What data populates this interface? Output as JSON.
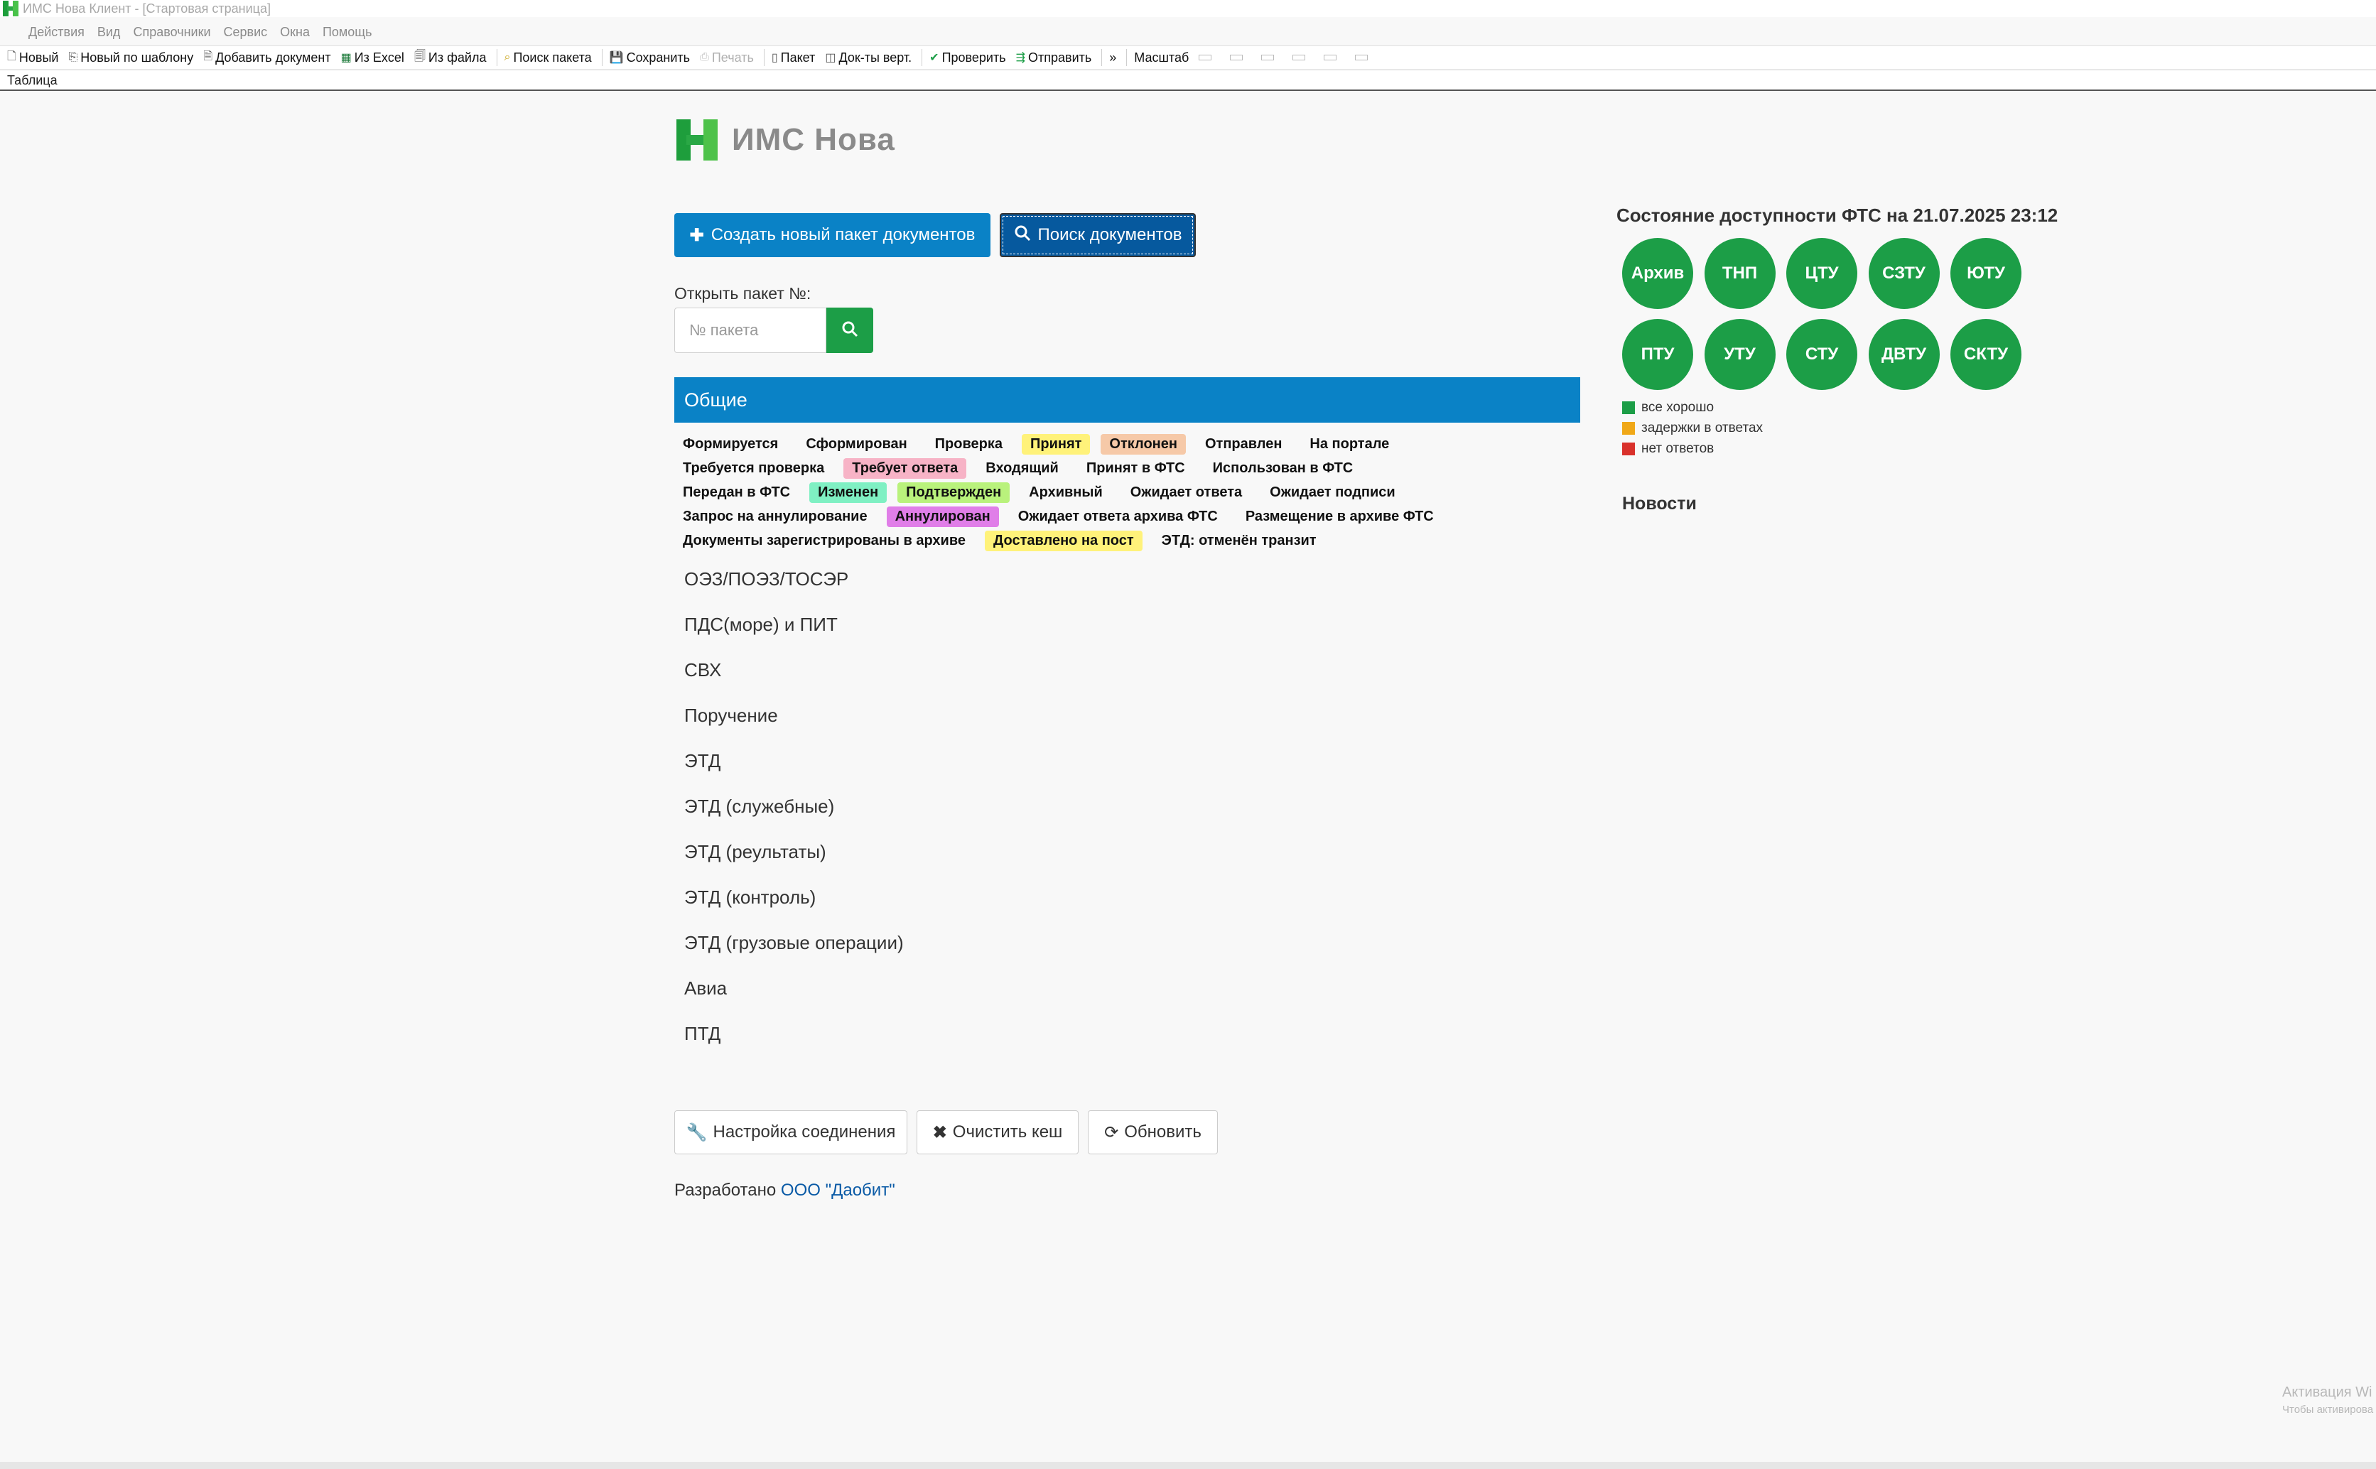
{
  "window": {
    "title": "ИМС Нова Клиент - [Стартовая страница]"
  },
  "menu": [
    "Действия",
    "Вид",
    "Справочники",
    "Сервис",
    "Окна",
    "Помощь"
  ],
  "toolbar": {
    "new": "Новый",
    "new_template": "Новый по шаблону",
    "add_doc": "Добавить документ",
    "from_excel": "Из Excel",
    "from_file": "Из файла",
    "search_pkg": "Поиск пакета",
    "save": "Сохранить",
    "print": "Печать",
    "package": "Пакет",
    "docs_vert": "Док-ты верт.",
    "check": "Проверить",
    "send": "Отправить",
    "more": "»",
    "scale": "Масштаб"
  },
  "tab": "Таблица",
  "logo_text": "ИМС Нова",
  "actions": {
    "create": "Создать новый пакет документов",
    "search": "Поиск документов"
  },
  "open_pkg": {
    "label": "Открыть пакет №:",
    "placeholder": "№ пакета"
  },
  "section_title": "Общие",
  "statuses": [
    [
      {
        "label": "Формируется",
        "bg": ""
      },
      {
        "label": "Сформирован",
        "bg": ""
      },
      {
        "label": "Проверка",
        "bg": ""
      },
      {
        "label": "Принят",
        "bg": "#fff27a"
      },
      {
        "label": "Отклонен",
        "bg": "#f6c9a8"
      },
      {
        "label": "Отправлен",
        "bg": ""
      },
      {
        "label": "На портале",
        "bg": ""
      }
    ],
    [
      {
        "label": "Требуется проверка",
        "bg": ""
      },
      {
        "label": "Требует ответа",
        "bg": "#f7b3c6"
      },
      {
        "label": "Входящий",
        "bg": ""
      },
      {
        "label": "Принят в ФТС",
        "bg": ""
      },
      {
        "label": "Использован в ФТС",
        "bg": ""
      }
    ],
    [
      {
        "label": "Передан в ФТС",
        "bg": ""
      },
      {
        "label": "Изменен",
        "bg": "#7ff0c3"
      },
      {
        "label": "Подтвержден",
        "bg": "#b9f27c"
      },
      {
        "label": "Архивный",
        "bg": ""
      },
      {
        "label": "Ожидает ответа",
        "bg": ""
      },
      {
        "label": "Ожидает подписи",
        "bg": ""
      }
    ],
    [
      {
        "label": "Запрос на аннулирование",
        "bg": ""
      },
      {
        "label": "Аннулирован",
        "bg": "#e07ee8"
      },
      {
        "label": "Ожидает ответа архива ФТС",
        "bg": ""
      },
      {
        "label": "Размещение в архиве ФТС",
        "bg": ""
      }
    ],
    [
      {
        "label": "Документы зарегистрированы в архиве",
        "bg": ""
      },
      {
        "label": "Доставлено на пост",
        "bg": "#fff27a"
      },
      {
        "label": "ЭТД: отменён транзит",
        "bg": ""
      }
    ]
  ],
  "doc_groups": [
    "ОЭЗ/ПОЭЗ/ТОСЭР",
    "ПДС(море) и ПИТ",
    "СВХ",
    "Поручение",
    "ЭТД",
    "ЭТД (служебные)",
    "ЭТД (реультаты)",
    "ЭТД (контроль)",
    "ЭТД (грузовые операции)",
    "Авиа",
    "ПТД"
  ],
  "footer_buttons": {
    "connection": "Настройка соединения",
    "cache": "Очистить кеш",
    "refresh": "Обновить"
  },
  "credit": {
    "prefix": "Разработано ",
    "link": "ООО \"Даобит\""
  },
  "fts": {
    "title": "Состояние доступности ФТС на 21.07.2025 23:12",
    "nodes": [
      "Архив",
      "ТНП",
      "ЦТУ",
      "СЗТУ",
      "ЮТУ",
      "ПТУ",
      "УТУ",
      "СТУ",
      "ДВТУ",
      "СКТУ"
    ],
    "legend": [
      {
        "label": "все хорошо",
        "color": "#1c9e47"
      },
      {
        "label": "задержки в ответах",
        "color": "#f0a818"
      },
      {
        "label": "нет ответов",
        "color": "#d9312b"
      }
    ]
  },
  "news_title": "Новости",
  "watermark": {
    "line1": "Активация Wi",
    "line2": "Чтобы активирова"
  },
  "colors": {
    "primary": "#0a82c6",
    "primary_dark": "#06599e",
    "success": "#1c9e47"
  }
}
